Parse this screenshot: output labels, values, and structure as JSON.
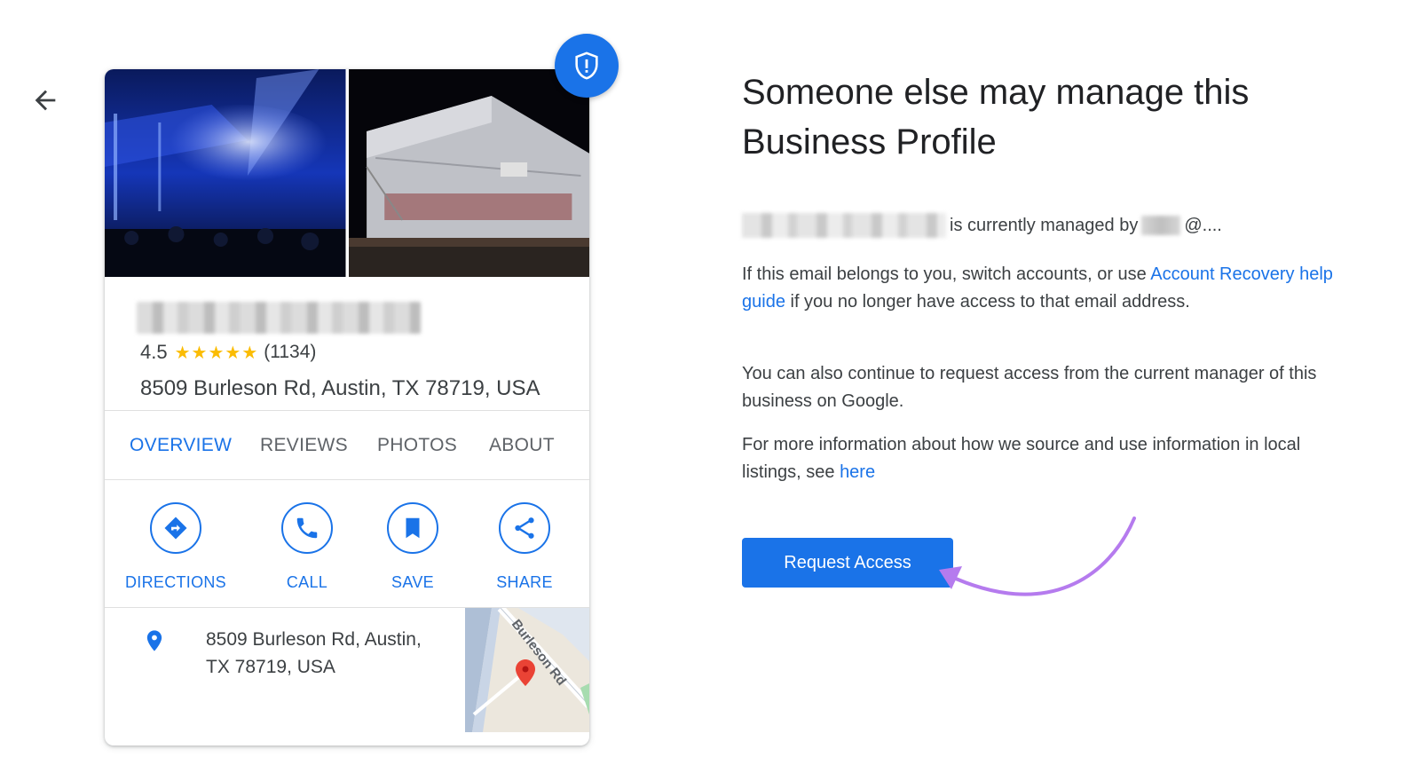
{
  "nav": {
    "back_icon": "arrow-left-icon"
  },
  "card": {
    "badge_icon": "shield-alert-icon",
    "rating": "4.5",
    "stars": "★★★★★",
    "review_count": "(1134)",
    "address": "8509 Burleson Rd, Austin, TX 78719, USA",
    "tabs": [
      {
        "label": "OVERVIEW",
        "active": true
      },
      {
        "label": "REVIEWS",
        "active": false
      },
      {
        "label": "PHOTOS",
        "active": false
      },
      {
        "label": "ABOUT",
        "active": false
      }
    ],
    "actions": [
      {
        "label": "DIRECTIONS",
        "icon": "directions-icon"
      },
      {
        "label": "CALL",
        "icon": "phone-icon"
      },
      {
        "label": "SAVE",
        "icon": "bookmark-icon"
      },
      {
        "label": "SHARE",
        "icon": "share-icon"
      }
    ],
    "address_detail": "8509 Burleson Rd, Austin, TX 78719, USA",
    "map_label": "Burleson Rd"
  },
  "panel": {
    "heading": "Someone else may manage this Business Profile",
    "managed_text": "is currently managed by",
    "managed_email_suffix": "@....",
    "p1_before": "If this email belongs to you, switch accounts, or use ",
    "p1_link": "Account Recovery help guide",
    "p1_after": " if you no longer have access to that email address.",
    "p2": "You can also continue to request access from the current manager of this business on Google.",
    "p3_before": "For more information about how we source and use information in local listings, see ",
    "p3_link": "here",
    "request_button": "Request Access"
  },
  "colors": {
    "accent": "#1a73e8",
    "star": "#fbbc04",
    "arrow": "#b57bee",
    "pin": "#1a73e8"
  }
}
